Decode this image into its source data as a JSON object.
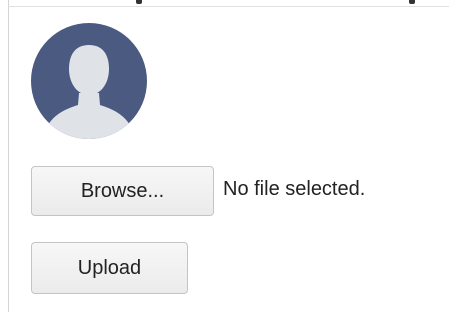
{
  "avatar": {
    "icon": "user-silhouette-icon",
    "background_color": "#4a5a80",
    "figure_color": "#dfe3e8"
  },
  "file_input": {
    "browse_label": "Browse...",
    "status_text": "No file selected."
  },
  "actions": {
    "upload_label": "Upload"
  }
}
